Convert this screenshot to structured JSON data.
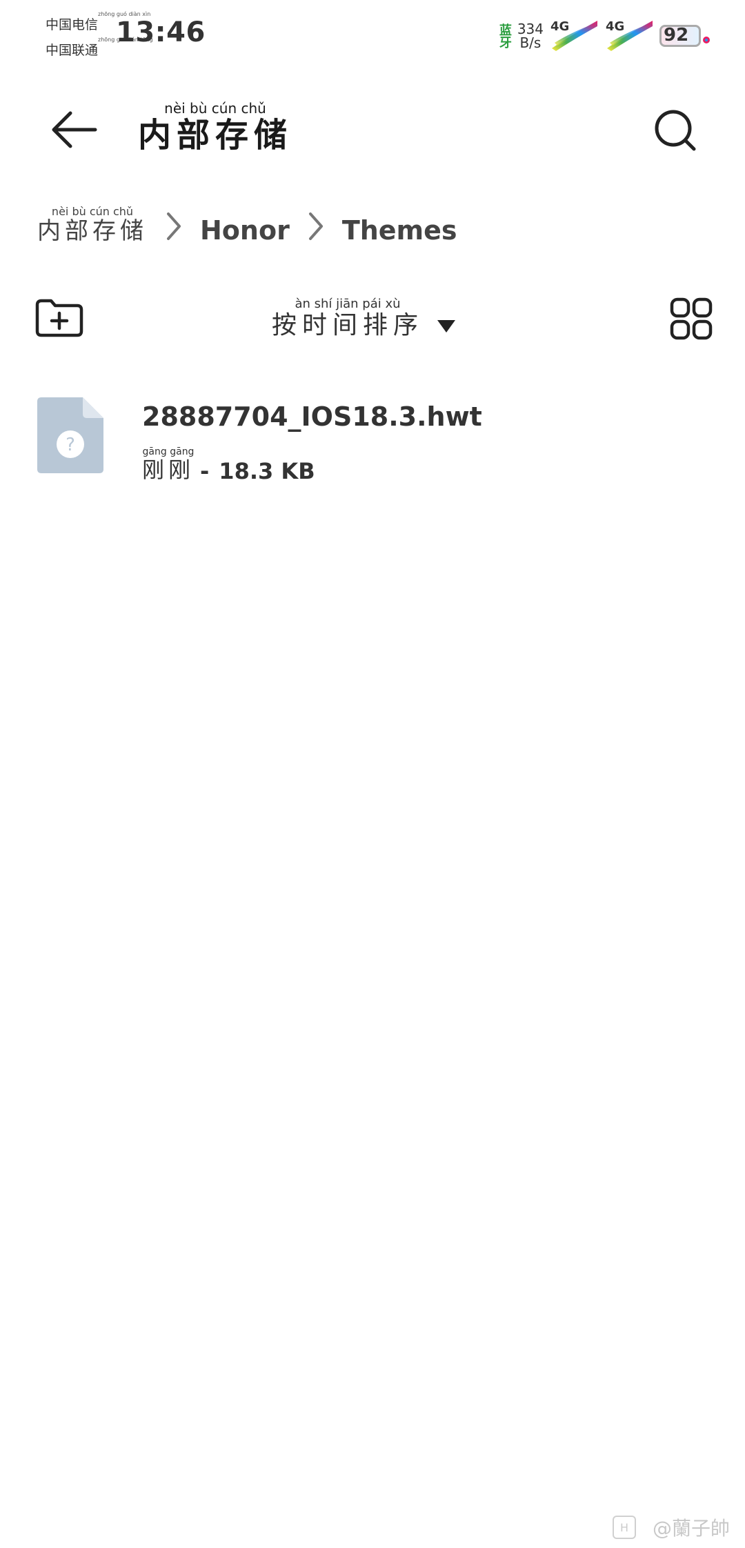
{
  "status_bar": {
    "carrier_1": "中国电信",
    "carrier_2": "中国联通",
    "time": "13:46",
    "bluetooth_label": "蓝牙",
    "net_speed_value": "334",
    "net_speed_unit": "B/s",
    "signal_1_label": "4G",
    "signal_2_label": "4G",
    "battery_level": "92"
  },
  "header": {
    "title": "内部存储",
    "back_icon": "arrow-left-icon",
    "search_icon": "search-icon"
  },
  "breadcrumb": {
    "items": [
      "内部存储",
      "Honor",
      "Themes"
    ]
  },
  "toolbar": {
    "new_folder_icon": "folder-plus-icon",
    "sort_label": "按时间排序",
    "view_toggle_icon": "grid-view-icon"
  },
  "files": [
    {
      "name": "28887704_IOS18.3.hwt",
      "modified": "刚刚",
      "separator": "-",
      "size": "18.3 KB",
      "icon": "unknown-file-icon"
    }
  ],
  "watermark": {
    "logo": "H",
    "text": "@蘭子帥"
  },
  "colors": {
    "background": "#ffffff",
    "text": "#333333",
    "file_icon": "#b8c7d6",
    "bluetooth": "#2a9d3e"
  }
}
